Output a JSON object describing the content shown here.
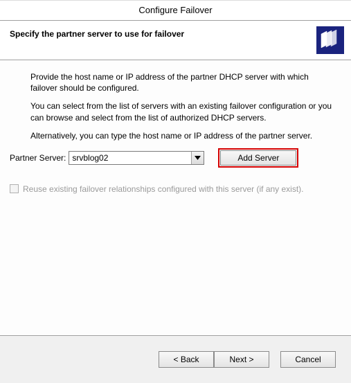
{
  "window": {
    "title": "Configure Failover"
  },
  "header": {
    "heading": "Specify the partner server to use for failover",
    "icon": "servers-icon"
  },
  "body": {
    "para1": "Provide the host name or IP address of the partner DHCP server with which failover should be configured.",
    "para2": "You can select from the list of servers with an existing failover configuration or you can browse and select from the list of authorized DHCP servers.",
    "para3": "Alternatively, you can type the host name or IP address of the partner server.",
    "partner_label": "Partner Server:",
    "partner_value": "srvblog02",
    "add_server_label": "Add Server",
    "reuse_label": "Reuse existing failover relationships configured with this server (if any exist).",
    "reuse_checked": false,
    "reuse_enabled": false
  },
  "footer": {
    "back": "< Back",
    "next": "Next >",
    "cancel": "Cancel"
  },
  "highlight": {
    "target": "add-server-button",
    "color": "#d40000"
  }
}
